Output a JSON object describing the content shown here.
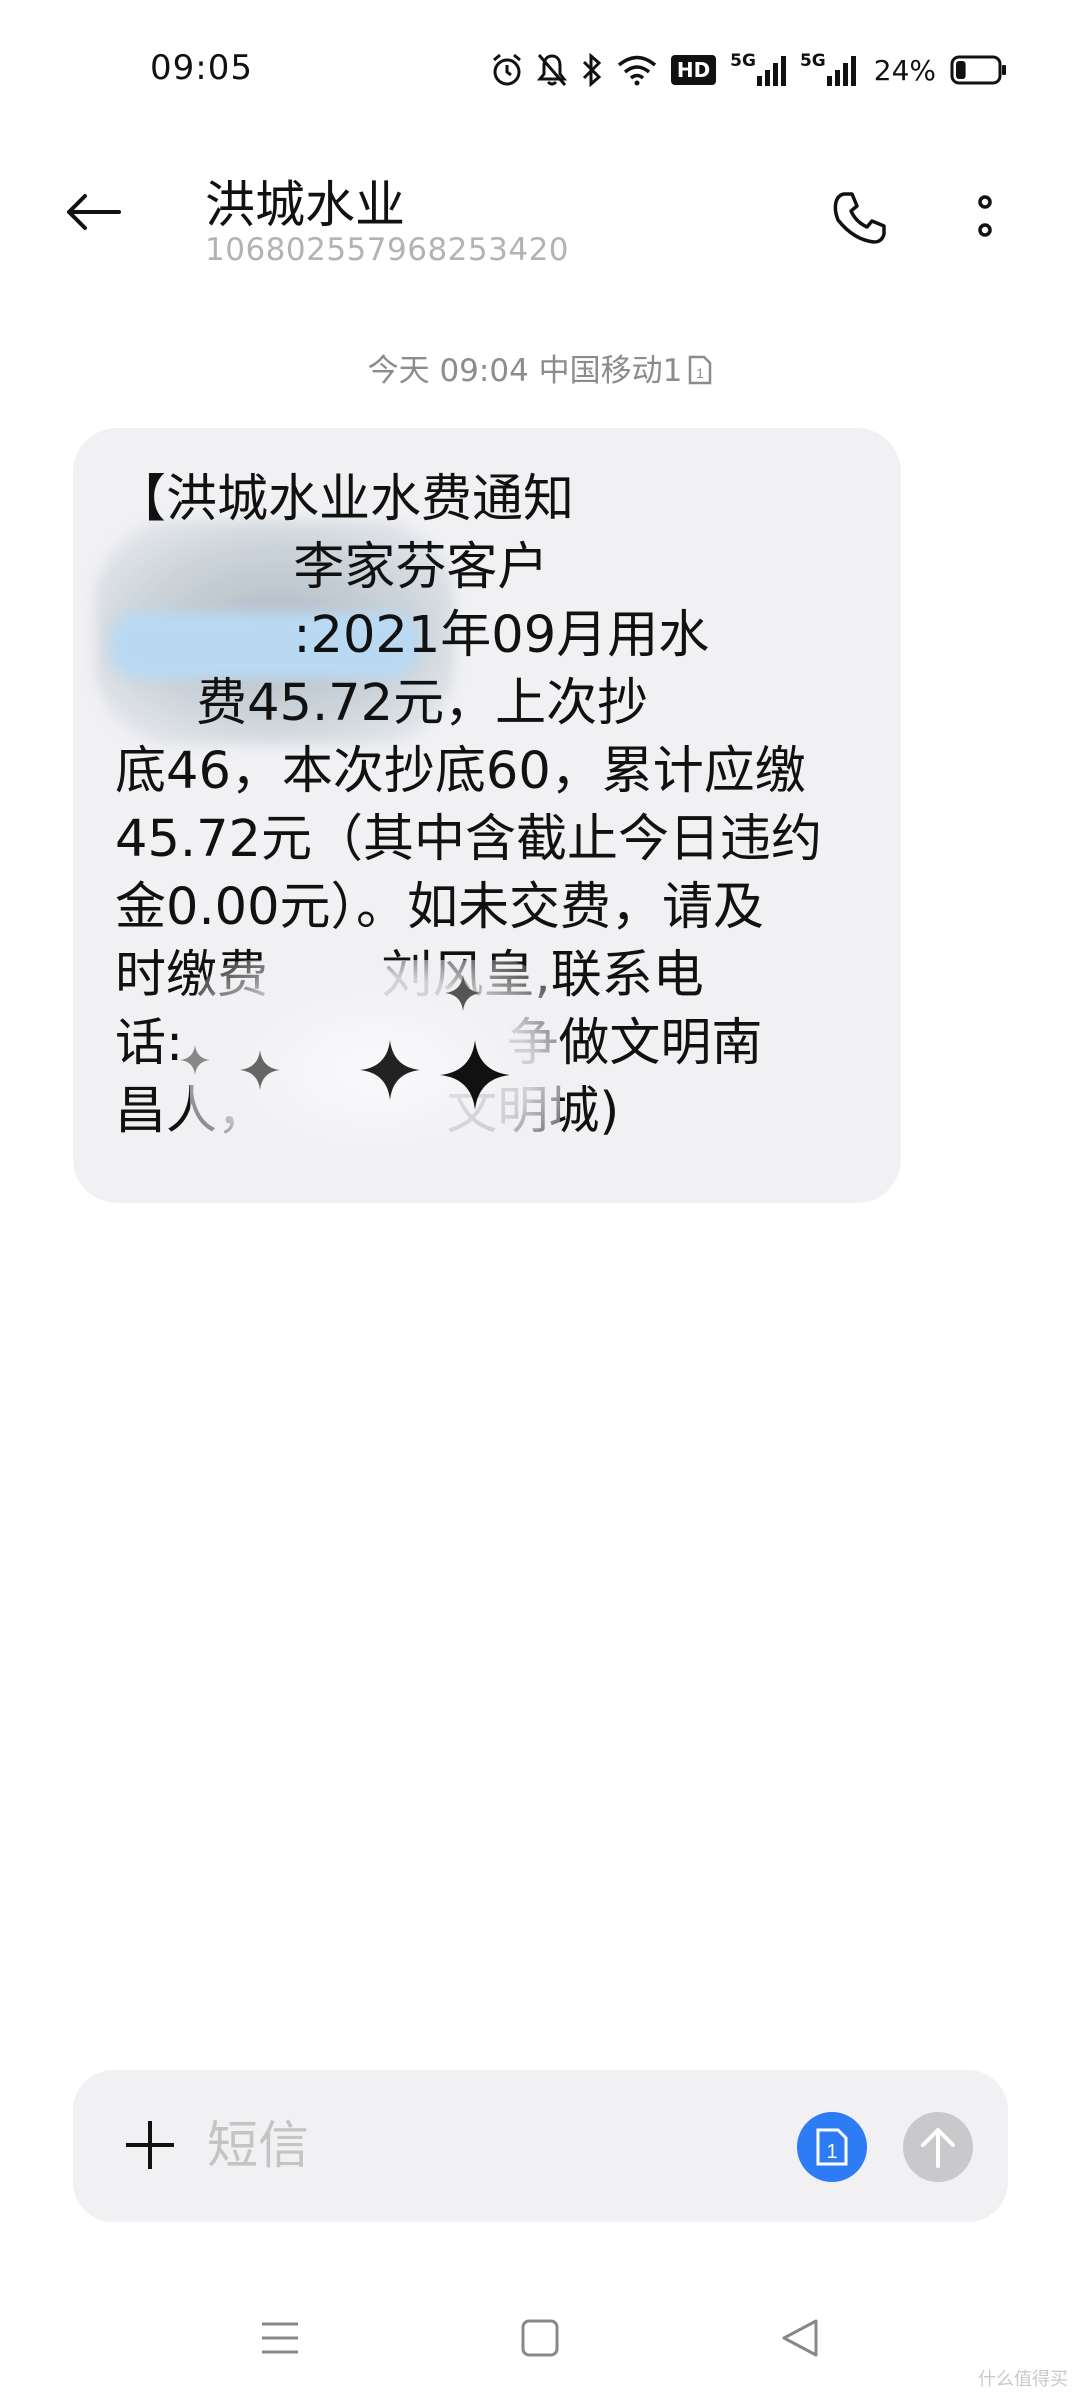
{
  "status_bar": {
    "time": "09:05",
    "icons": [
      "alarm-icon",
      "mute-icon",
      "bluetooth-icon",
      "wifi-icon",
      "hd-icon",
      "signal-5g-icon",
      "signal-5g-icon"
    ],
    "hd_label": "HD",
    "network_label": "5G",
    "battery_percent": "24%",
    "battery_level": 0.24
  },
  "header": {
    "contact_name": "洪城水业",
    "contact_number": "106802557968253420"
  },
  "message": {
    "meta": "今天 09:04 中国移动1",
    "sim_badge": "1",
    "body": "【洪城水业水费通知\n           李家芬客户\n           :2021年09月用水\n     费45.72元，上次抄\n底46，本次抄底60，累计应缴\n45.72元（其中含截止今日违约\n金0.00元）。如未交费，请及\n时缴费       刘风皇,联系电\n话:                    争做文明南\n昌人，           文明城)"
  },
  "compose": {
    "placeholder": "短信",
    "sim_badge": "1"
  },
  "watermark": "什么值得买",
  "colors": {
    "bubble": "#f1f1f4",
    "accent_blue": "#2d7cf6",
    "send_disabled": "#c9c9cc",
    "muted_text": "#8c8c8c"
  }
}
